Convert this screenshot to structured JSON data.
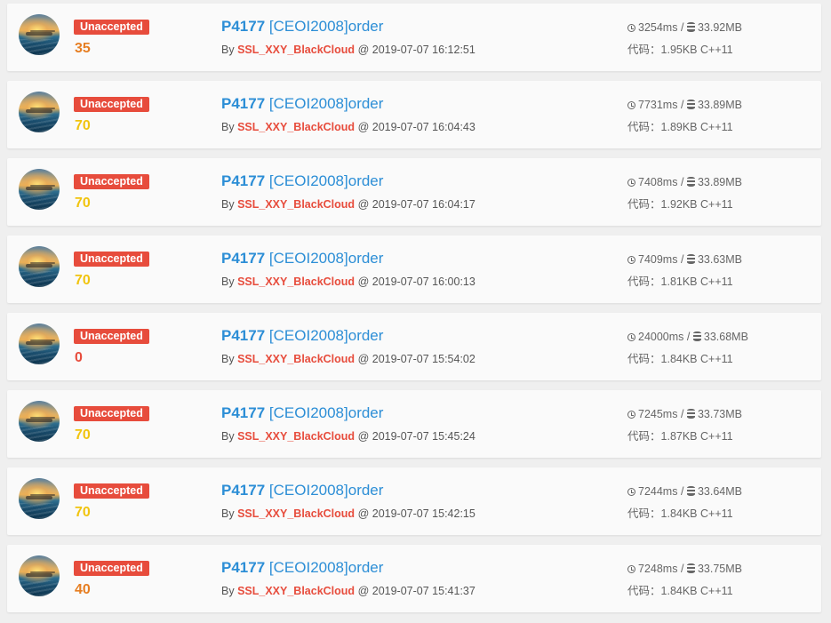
{
  "labels": {
    "by": "By",
    "at": "@",
    "slash": "/",
    "code_prefix": "代码："
  },
  "colors": {
    "status_bg": "#e74c3c",
    "score_35": "#e67e22",
    "score_70": "#f1c40f",
    "score_0": "#e74c3c",
    "score_40": "#e67e22",
    "link": "#2c8ed6",
    "user": "#e74c3c"
  },
  "records": [
    {
      "status": "Unaccepted",
      "score": "35",
      "score_color": "#e67e22",
      "pid": "P4177",
      "title": "[CEOI2008]order",
      "user": "SSL_XXY_BlackCloud",
      "time": "2019-07-07 16:12:51",
      "runtime": "3254ms",
      "memory": "33.92MB",
      "code_size": "1.95KB",
      "lang": "C++11"
    },
    {
      "status": "Unaccepted",
      "score": "70",
      "score_color": "#f1c40f",
      "pid": "P4177",
      "title": "[CEOI2008]order",
      "user": "SSL_XXY_BlackCloud",
      "time": "2019-07-07 16:04:43",
      "runtime": "7731ms",
      "memory": "33.89MB",
      "code_size": "1.89KB",
      "lang": "C++11"
    },
    {
      "status": "Unaccepted",
      "score": "70",
      "score_color": "#f1c40f",
      "pid": "P4177",
      "title": "[CEOI2008]order",
      "user": "SSL_XXY_BlackCloud",
      "time": "2019-07-07 16:04:17",
      "runtime": "7408ms",
      "memory": "33.89MB",
      "code_size": "1.92KB",
      "lang": "C++11"
    },
    {
      "status": "Unaccepted",
      "score": "70",
      "score_color": "#f1c40f",
      "pid": "P4177",
      "title": "[CEOI2008]order",
      "user": "SSL_XXY_BlackCloud",
      "time": "2019-07-07 16:00:13",
      "runtime": "7409ms",
      "memory": "33.63MB",
      "code_size": "1.81KB",
      "lang": "C++11"
    },
    {
      "status": "Unaccepted",
      "score": "0",
      "score_color": "#e74c3c",
      "pid": "P4177",
      "title": "[CEOI2008]order",
      "user": "SSL_XXY_BlackCloud",
      "time": "2019-07-07 15:54:02",
      "runtime": "24000ms",
      "memory": "33.68MB",
      "code_size": "1.84KB",
      "lang": "C++11"
    },
    {
      "status": "Unaccepted",
      "score": "70",
      "score_color": "#f1c40f",
      "pid": "P4177",
      "title": "[CEOI2008]order",
      "user": "SSL_XXY_BlackCloud",
      "time": "2019-07-07 15:45:24",
      "runtime": "7245ms",
      "memory": "33.73MB",
      "code_size": "1.87KB",
      "lang": "C++11"
    },
    {
      "status": "Unaccepted",
      "score": "70",
      "score_color": "#f1c40f",
      "pid": "P4177",
      "title": "[CEOI2008]order",
      "user": "SSL_XXY_BlackCloud",
      "time": "2019-07-07 15:42:15",
      "runtime": "7244ms",
      "memory": "33.64MB",
      "code_size": "1.84KB",
      "lang": "C++11"
    },
    {
      "status": "Unaccepted",
      "score": "40",
      "score_color": "#e67e22",
      "pid": "P4177",
      "title": "[CEOI2008]order",
      "user": "SSL_XXY_BlackCloud",
      "time": "2019-07-07 15:41:37",
      "runtime": "7248ms",
      "memory": "33.75MB",
      "code_size": "1.84KB",
      "lang": "C++11"
    }
  ]
}
